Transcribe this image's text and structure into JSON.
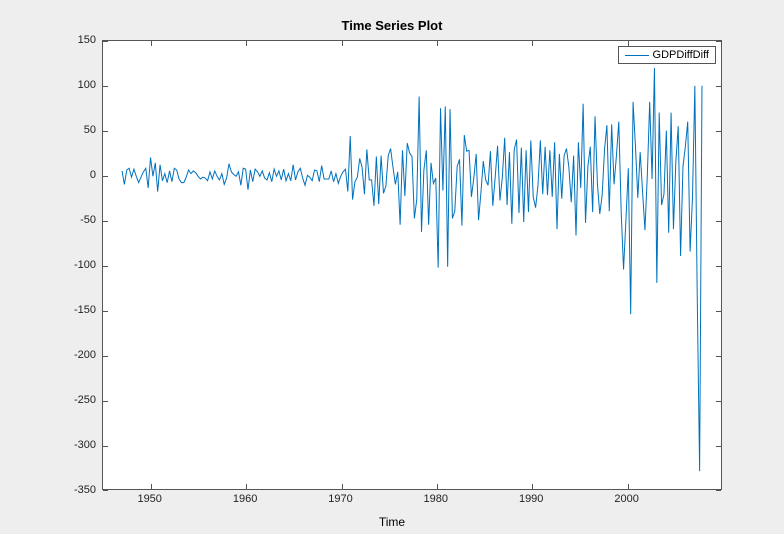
{
  "chart_data": {
    "type": "line",
    "title": "Time Series Plot",
    "xlabel": "Time",
    "ylabel": "",
    "xlim": [
      1945,
      2010
    ],
    "ylim": [
      -350,
      150
    ],
    "xticks": [
      1950,
      1960,
      1970,
      1980,
      1990,
      2000
    ],
    "yticks": [
      -350,
      -300,
      -250,
      -200,
      -150,
      -100,
      -50,
      0,
      50,
      100,
      150
    ],
    "series": [
      {
        "name": "GDPDiffDiff",
        "color": "#0072bd",
        "x": [
          1947.0,
          1947.25,
          1947.5,
          1947.75,
          1948.0,
          1948.25,
          1948.5,
          1948.75,
          1949.0,
          1949.25,
          1949.5,
          1949.75,
          1950.0,
          1950.25,
          1950.5,
          1950.75,
          1951.0,
          1951.25,
          1951.5,
          1951.75,
          1952.0,
          1952.25,
          1952.5,
          1952.75,
          1953.0,
          1953.25,
          1953.5,
          1953.75,
          1954.0,
          1954.25,
          1954.5,
          1954.75,
          1955.0,
          1955.25,
          1955.5,
          1955.75,
          1956.0,
          1956.25,
          1956.5,
          1956.75,
          1957.0,
          1957.25,
          1957.5,
          1957.75,
          1958.0,
          1958.25,
          1958.5,
          1958.75,
          1959.0,
          1959.25,
          1959.5,
          1959.75,
          1960.0,
          1960.25,
          1960.5,
          1960.75,
          1961.0,
          1961.25,
          1961.5,
          1961.75,
          1962.0,
          1962.25,
          1962.5,
          1962.75,
          1963.0,
          1963.25,
          1963.5,
          1963.75,
          1964.0,
          1964.25,
          1964.5,
          1964.75,
          1965.0,
          1965.25,
          1965.5,
          1965.75,
          1966.0,
          1966.25,
          1966.5,
          1966.75,
          1967.0,
          1967.25,
          1967.5,
          1967.75,
          1968.0,
          1968.25,
          1968.5,
          1968.75,
          1969.0,
          1969.25,
          1969.5,
          1969.75,
          1970.0,
          1970.25,
          1970.5,
          1970.75,
          1971.0,
          1971.25,
          1971.5,
          1971.75,
          1972.0,
          1972.25,
          1972.5,
          1972.75,
          1973.0,
          1973.25,
          1973.5,
          1973.75,
          1974.0,
          1974.25,
          1974.5,
          1974.75,
          1975.0,
          1975.25,
          1975.5,
          1975.75,
          1976.0,
          1976.25,
          1976.5,
          1976.75,
          1977.0,
          1977.25,
          1977.5,
          1977.75,
          1978.0,
          1978.25,
          1978.5,
          1978.75,
          1979.0,
          1979.25,
          1979.5,
          1979.75,
          1980.0,
          1980.25,
          1980.5,
          1980.75,
          1981.0,
          1981.25,
          1981.5,
          1981.75,
          1982.0,
          1982.25,
          1982.5,
          1982.75,
          1983.0,
          1983.25,
          1983.5,
          1983.75,
          1984.0,
          1984.25,
          1984.5,
          1984.75,
          1985.0,
          1985.25,
          1985.5,
          1985.75,
          1986.0,
          1986.25,
          1986.5,
          1986.75,
          1987.0,
          1987.25,
          1987.5,
          1987.75,
          1988.0,
          1988.25,
          1988.5,
          1988.75,
          1989.0,
          1989.25,
          1989.5,
          1989.75,
          1990.0,
          1990.25,
          1990.5,
          1990.75,
          1991.0,
          1991.25,
          1991.5,
          1991.75,
          1992.0,
          1992.25,
          1992.5,
          1992.75,
          1993.0,
          1993.25,
          1993.5,
          1993.75,
          1994.0,
          1994.25,
          1994.5,
          1994.75,
          1995.0,
          1995.25,
          1995.5,
          1995.75,
          1996.0,
          1996.25,
          1996.5,
          1996.75,
          1997.0,
          1997.25,
          1997.5,
          1997.75,
          1998.0,
          1998.25,
          1998.5,
          1998.75,
          1999.0,
          1999.25,
          1999.5,
          1999.75,
          2000.0,
          2000.25,
          2000.5,
          2000.75,
          2001.0,
          2001.25,
          2001.5,
          2001.75,
          2002.0,
          2002.25,
          2002.5,
          2002.75,
          2003.0,
          2003.25,
          2003.5,
          2003.75,
          2004.0,
          2004.25,
          2004.5,
          2004.75,
          2005.0,
          2005.25,
          2005.5,
          2005.75,
          2006.0,
          2006.25,
          2006.5,
          2006.75,
          2007.0,
          2007.25,
          2007.5,
          2007.75,
          2008.0,
          2008.25,
          2008.5,
          2008.75,
          2009.0
        ],
        "y": [
          5,
          -10,
          6,
          8,
          -2,
          7,
          -1,
          -8,
          -2,
          4,
          8,
          -14,
          20,
          -1,
          14,
          -18,
          12,
          -6,
          2,
          -8,
          5,
          -7,
          8,
          6,
          -4,
          -8,
          -8,
          -2,
          6,
          2,
          5,
          3,
          -1,
          -4,
          -2,
          -3,
          -6,
          4,
          -4,
          5,
          -1,
          -5,
          2,
          -10,
          -3,
          13,
          4,
          1,
          -1,
          4,
          -11,
          8,
          7,
          -16,
          6,
          -7,
          7,
          4,
          -1,
          5,
          -3,
          -5,
          3,
          -7,
          7,
          -1,
          5,
          -5,
          7,
          -6,
          2,
          -6,
          12,
          -5,
          4,
          8,
          -3,
          -11,
          0,
          -2,
          -6,
          6,
          5,
          -7,
          11,
          -4,
          -4,
          -4,
          5,
          -7,
          2,
          -9,
          -1,
          4,
          7,
          -18,
          44,
          -27,
          -7,
          -2,
          19,
          9,
          -21,
          29,
          -5,
          -5,
          -34,
          21,
          -32,
          22,
          -20,
          -12,
          22,
          30,
          9,
          -10,
          4,
          -55,
          28,
          -23,
          36,
          25,
          21,
          -48,
          -27,
          88,
          -63,
          6,
          28,
          -55,
          14,
          -9,
          -3,
          -103,
          75,
          -17,
          77,
          -102,
          74,
          -48,
          -40,
          10,
          18,
          -56,
          45,
          27,
          28,
          -24,
          -3,
          24,
          -50,
          -19,
          16,
          -5,
          -11,
          27,
          -34,
          -2,
          33,
          -28,
          -2,
          42,
          -33,
          26,
          -54,
          29,
          40,
          -42,
          31,
          -52,
          28,
          -41,
          39,
          -24,
          -36,
          -11,
          39,
          -21,
          32,
          -22,
          28,
          -24,
          37,
          -60,
          24,
          -26,
          22,
          30,
          9,
          -30,
          22,
          -67,
          37,
          -14,
          80,
          -53,
          10,
          32,
          -41,
          66,
          -9,
          -43,
          -22,
          29,
          56,
          -40,
          57,
          -10,
          22,
          60,
          -40,
          -105,
          -50,
          8,
          -155,
          82,
          33,
          -25,
          26,
          -18,
          -61,
          0,
          82,
          -4,
          120,
          -120,
          70,
          -33,
          -21,
          50,
          -64,
          70,
          -60,
          15,
          55,
          -90,
          10,
          32,
          60,
          -85,
          -25,
          100,
          -135,
          -330,
          100
        ]
      }
    ],
    "legend": {
      "entries": [
        "GDPDiffDiff"
      ],
      "position": "northeast"
    }
  }
}
